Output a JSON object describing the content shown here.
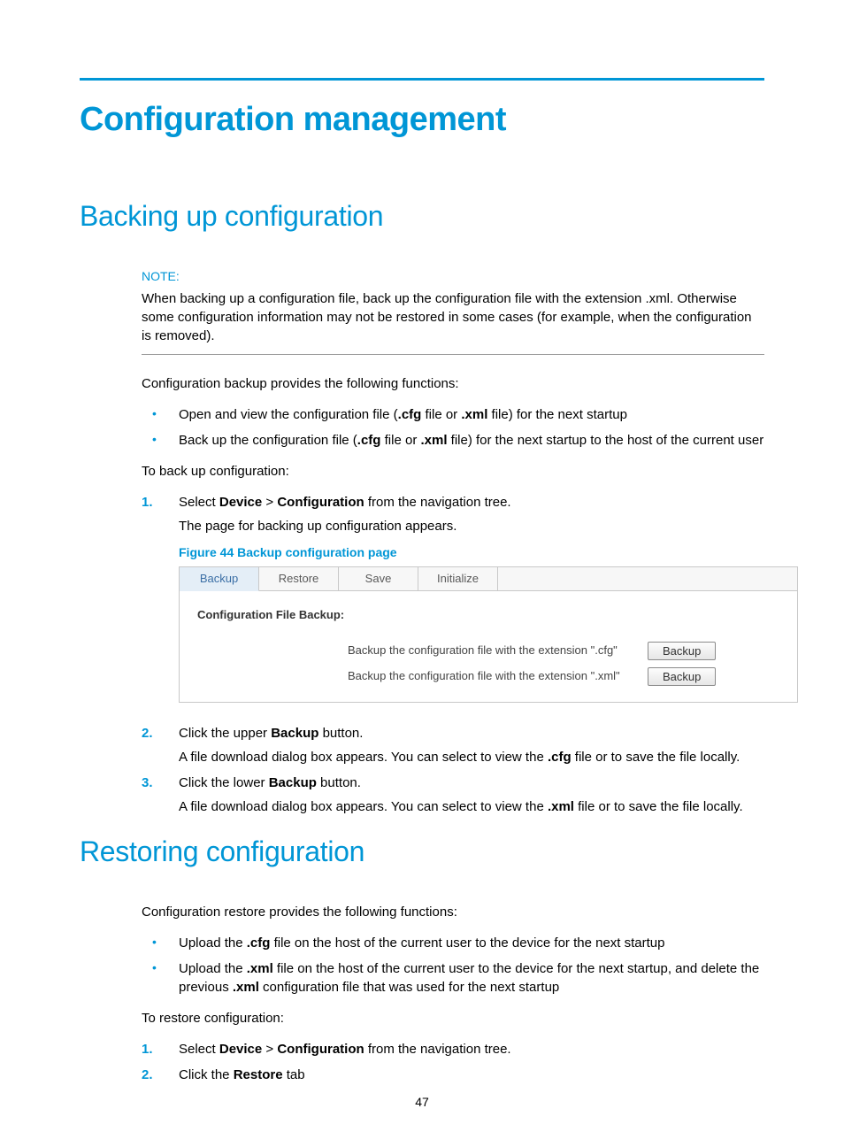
{
  "title": "Configuration management",
  "page_number": "47",
  "section_backup": {
    "heading": "Backing up configuration",
    "note_label": "NOTE:",
    "note_body": "When backing up a configuration file, back up the configuration file with the extension .xml. Otherwise some configuration information may not be restored in some cases (for example, when the configuration is removed).",
    "intro": "Configuration backup provides the following functions:",
    "bullets": {
      "b1_a": "Open and view the configuration file (",
      "b1_b": ".cfg",
      "b1_c": " file or ",
      "b1_d": ".xml",
      "b1_e": " file) for the next startup",
      "b2_a": "Back up the configuration file (",
      "b2_b": ".cfg",
      "b2_c": " file or ",
      "b2_d": ".xml",
      "b2_e": " file) for the next startup to the host of the current user"
    },
    "lead_steps": "To back up configuration:",
    "steps": {
      "s1_a": "Select ",
      "s1_device": "Device",
      "s1_gt": " > ",
      "s1_conf": "Configuration",
      "s1_b": " from the navigation tree.",
      "s1_sub": "The page for backing up configuration appears.",
      "s2_a": "Click the upper ",
      "s2_b": "Backup",
      "s2_c": " button.",
      "s2_sub_a": "A file download dialog box appears. You can select to view the ",
      "s2_sub_b": ".cfg",
      "s2_sub_c": " file or to save the file locally.",
      "s3_a": "Click the lower ",
      "s3_b": "Backup",
      "s3_c": " button.",
      "s3_sub_a": "A file download dialog box appears. You can select to view the ",
      "s3_sub_b": ".xml",
      "s3_sub_c": " file or to save the file locally."
    },
    "figure_caption": "Figure 44 Backup configuration page",
    "ui": {
      "tabs": {
        "backup": "Backup",
        "restore": "Restore",
        "save": "Save",
        "initialize": "Initialize"
      },
      "subtitle": "Configuration File Backup:",
      "row1_text": "Backup the configuration file with the extension \".cfg\"",
      "row2_text": "Backup the configuration file with the extension \".xml\"",
      "btn_label": "Backup"
    }
  },
  "section_restore": {
    "heading": "Restoring configuration",
    "intro": "Configuration restore provides the following functions:",
    "bullets": {
      "b1_a": "Upload the ",
      "b1_b": ".cfg",
      "b1_c": " file on the host of the current user to the device for the next startup",
      "b2_a": "Upload the ",
      "b2_b": ".xml",
      "b2_c": " file on the host of the current user to the device for the next startup, and delete the previous ",
      "b2_d": ".xml",
      "b2_e": " configuration file that was used for the next startup"
    },
    "lead_steps": "To restore configuration:",
    "steps": {
      "s1_a": "Select ",
      "s1_device": "Device",
      "s1_gt": " > ",
      "s1_conf": "Configuration",
      "s1_b": " from the navigation tree.",
      "s2_a": "Click the ",
      "s2_b": "Restore",
      "s2_c": " tab"
    }
  }
}
